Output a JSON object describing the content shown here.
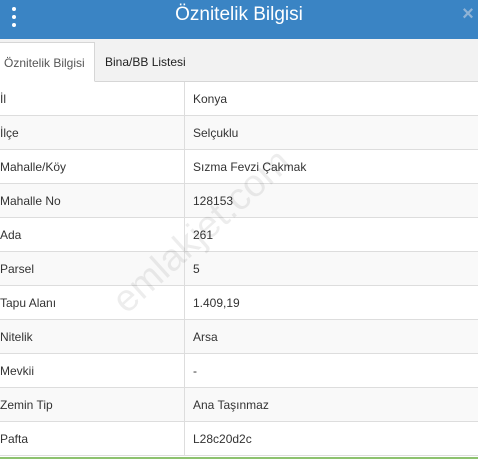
{
  "header": {
    "title": "Öznitelik Bilgisi",
    "close_glyph": "×",
    "menu_icon": "vertical-dots-icon"
  },
  "tabs": [
    {
      "label": "Öznitelik Bilgisi",
      "active": true
    },
    {
      "label": "Bina/BB Listesi",
      "active": false
    }
  ],
  "rows": [
    {
      "label": "İl",
      "value": "Konya"
    },
    {
      "label": "İlçe",
      "value": "Selçuklu"
    },
    {
      "label": "Mahalle/Köy",
      "value": "Sızma Fevzi Çakmak"
    },
    {
      "label": "Mahalle No",
      "value": "128153"
    },
    {
      "label": "Ada",
      "value": "261"
    },
    {
      "label": "Parsel",
      "value": "5"
    },
    {
      "label": "Tapu Alanı",
      "value": "1.409,19"
    },
    {
      "label": "Nitelik",
      "value": "Arsa"
    },
    {
      "label": "Mevkii",
      "value": "-"
    },
    {
      "label": "Zemin Tip",
      "value": "Ana Taşınmaz"
    },
    {
      "label": "Pafta",
      "value": "L28c20d2c"
    }
  ],
  "watermark": "emlakjet.com",
  "colors": {
    "header_bg": "#3a84c4",
    "bottom_accent": "#8dc26f"
  }
}
